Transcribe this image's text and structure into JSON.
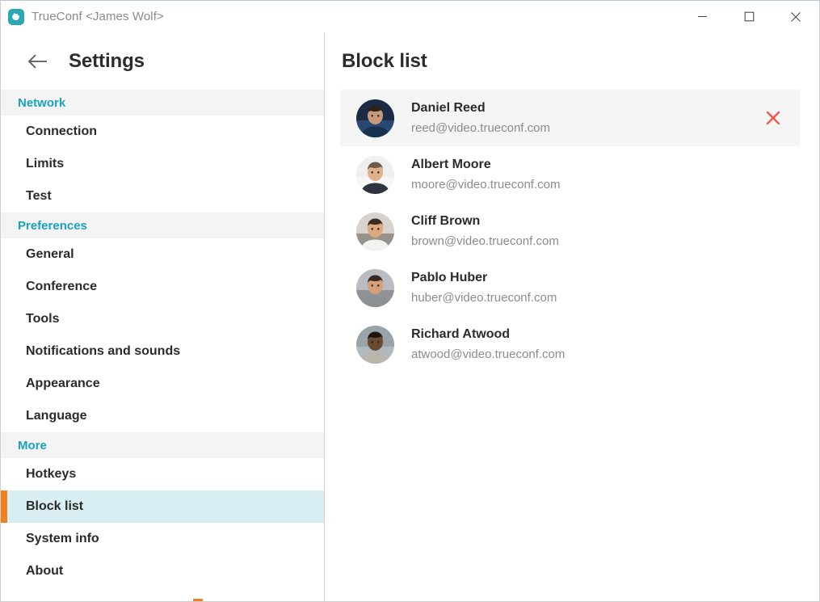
{
  "titlebar": {
    "app_name": "TrueConf <James Wolf>",
    "icon": "trueconf-logo-icon",
    "minimize_label": "Minimize",
    "maximize_label": "Maximize",
    "close_label": "Close"
  },
  "sidebar": {
    "back_icon": "back-arrow-icon",
    "title": "Settings",
    "groups": [
      {
        "label": "Network",
        "items": [
          {
            "label": "Connection",
            "selected": false
          },
          {
            "label": "Limits",
            "selected": false
          },
          {
            "label": "Test",
            "selected": false
          }
        ]
      },
      {
        "label": "Preferences",
        "items": [
          {
            "label": "General",
            "selected": false
          },
          {
            "label": "Conference",
            "selected": false
          },
          {
            "label": "Tools",
            "selected": false
          },
          {
            "label": "Notifications and sounds",
            "selected": false
          },
          {
            "label": "Appearance",
            "selected": false
          },
          {
            "label": "Language",
            "selected": false
          }
        ]
      },
      {
        "label": "More",
        "items": [
          {
            "label": "Hotkeys",
            "selected": false
          },
          {
            "label": "Block list",
            "selected": true
          },
          {
            "label": "System info",
            "selected": false
          },
          {
            "label": "About",
            "selected": false
          }
        ]
      }
    ]
  },
  "content": {
    "title": "Block list",
    "remove_icon": "close-x-icon",
    "remove_label": "Remove from block list",
    "items": [
      {
        "name": "Daniel Reed",
        "email": "reed@video.trueconf.com",
        "highlighted": true,
        "avatar": {
          "bg": "#1b2b45",
          "skin": "#c79a7a",
          "hair": "#2a2118",
          "clothes": "#17324f",
          "accent": "#3f6ea8"
        }
      },
      {
        "name": "Albert Moore",
        "email": "moore@video.trueconf.com",
        "highlighted": false,
        "avatar": {
          "bg": "#efefef",
          "skin": "#e0b089",
          "hair": "#6d5b4a",
          "clothes": "#2f3540",
          "accent": "#ffffff"
        }
      },
      {
        "name": "Cliff Brown",
        "email": "brown@video.trueconf.com",
        "highlighted": false,
        "avatar": {
          "bg": "#d8d3ce",
          "skin": "#dda97f",
          "hair": "#3b2a1d",
          "clothes": "#f2f2f2",
          "accent": "#4a4038"
        }
      },
      {
        "name": "Pablo Huber",
        "email": "huber@video.trueconf.com",
        "highlighted": false,
        "avatar": {
          "bg": "#b9bcc0",
          "skin": "#d5a079",
          "hair": "#372a20",
          "clothes": "#8d8f94",
          "accent": "#5e6166"
        }
      },
      {
        "name": "Richard Atwood",
        "email": "atwood@video.trueconf.com",
        "highlighted": false,
        "avatar": {
          "bg": "#9aa3a8",
          "skin": "#6b4a32",
          "hair": "#1d1510",
          "clothes": "#b9b4ac",
          "accent": "#cfd4d6"
        }
      }
    ]
  },
  "colors": {
    "accent_teal": "#1ba3be",
    "selection_bg": "#d9eef2",
    "selection_bar": "#ef8022",
    "remove_red": "#f4564c",
    "group_header_bg": "#f4f4f4",
    "row_highlight_bg": "#f5f5f5"
  }
}
